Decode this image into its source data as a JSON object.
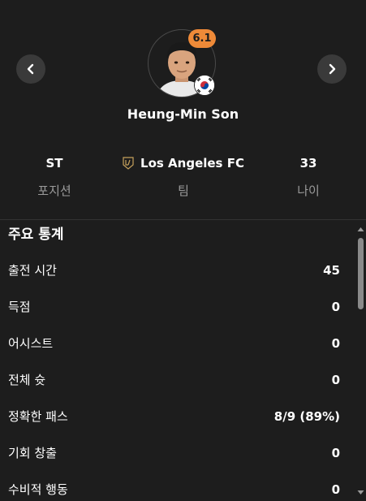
{
  "player": {
    "name": "Heung-Min Son",
    "rating": "6.1",
    "flag_icon": "south-korea-flag"
  },
  "nav": {
    "prev_icon": "chevron-left-icon",
    "next_icon": "chevron-right-icon"
  },
  "info": {
    "position_value": "ST",
    "position_label": "포지션",
    "team_value": "Los Angeles FC",
    "team_label": "팀",
    "age_value": "33",
    "age_label": "나이"
  },
  "stats": {
    "title": "주요 통계",
    "rows": [
      {
        "label": "출전 시간",
        "value": "45"
      },
      {
        "label": "득점",
        "value": "0"
      },
      {
        "label": "어시스트",
        "value": "0"
      },
      {
        "label": "전체 슛",
        "value": "0"
      },
      {
        "label": "정확한 패스",
        "value": "8/9 (89%)"
      },
      {
        "label": "기회 창출",
        "value": "0"
      },
      {
        "label": "수비적 행동",
        "value": "0"
      }
    ]
  },
  "colors": {
    "background": "#1d1d1d",
    "rating_badge": "#ef8a38",
    "team_gold": "#c6a15b"
  }
}
